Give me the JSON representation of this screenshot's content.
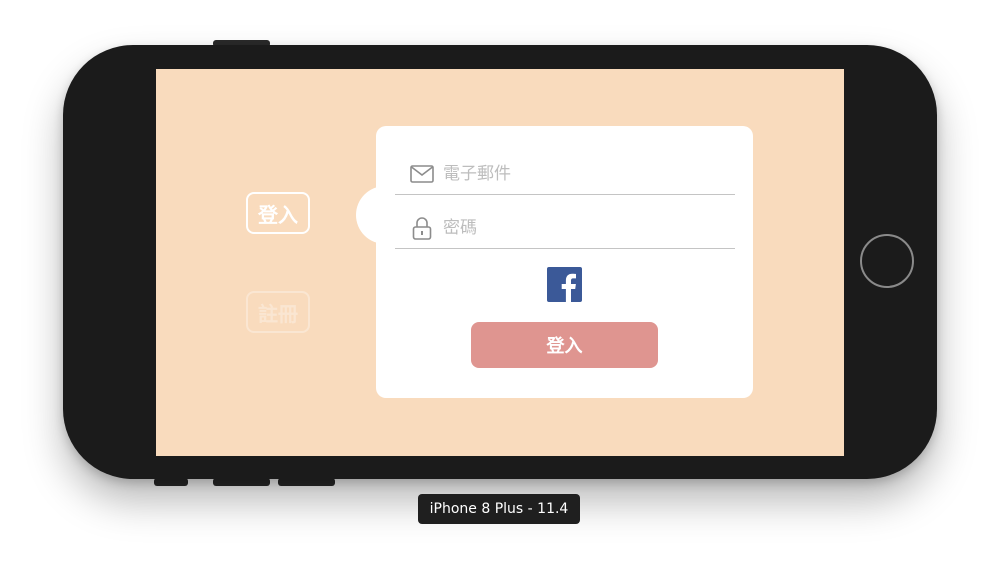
{
  "device": {
    "label": "iPhone 8 Plus - 11.4"
  },
  "side_tabs": {
    "login": "登入",
    "register": "註冊"
  },
  "form": {
    "email_placeholder": "電子郵件",
    "password_placeholder": "密碼",
    "submit_label": "登入"
  },
  "icons": {
    "email": "envelope-icon",
    "password": "lock-icon",
    "social": "facebook-icon"
  },
  "colors": {
    "screen_background": "#f9dbbd",
    "submit_button": "#df9590",
    "facebook": "#3b5998"
  }
}
